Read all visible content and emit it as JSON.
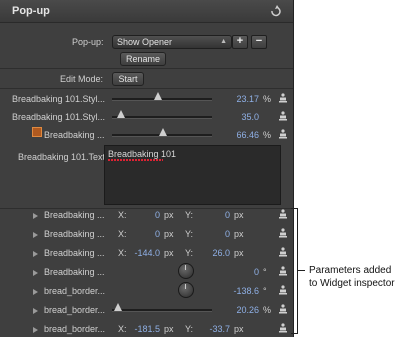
{
  "inspector": {
    "title": "Pop-up",
    "popup_label": "Pop-up:",
    "popup_value": "Show Opener",
    "plus": "+",
    "minus": "−",
    "rename": "Rename",
    "edit_mode_label": "Edit Mode:",
    "start": "Start"
  },
  "sliders": [
    {
      "label": "Breadbaking 101.Styl...",
      "value": "23.17",
      "unit": "%",
      "position": 0.42
    },
    {
      "label": "Breadbaking 101.Styl...",
      "value": "35.0",
      "unit": "",
      "position": 0.05
    },
    {
      "label": "Breadbaking ...",
      "value": "66.46",
      "unit": "%",
      "position": 0.47
    }
  ],
  "text_param": {
    "label": "Breadbaking 101.Text",
    "value": "Breadbaking 101"
  },
  "rows": [
    {
      "label": "Breadbaking ...",
      "x_label": "X:",
      "x": "0",
      "x_unit": "px",
      "y_label": "Y:",
      "y": "0",
      "y_unit": "px"
    },
    {
      "label": "Breadbaking ...",
      "x_label": "X:",
      "x": "0",
      "x_unit": "px",
      "y_label": "Y:",
      "y": "0",
      "y_unit": "px"
    },
    {
      "label": "Breadbaking ...",
      "x_label": "X:",
      "x": "-144.0",
      "x_unit": "px",
      "y_label": "Y:",
      "y": "26.0",
      "y_unit": "px"
    },
    {
      "label": "Breadbaking ...",
      "value": "0",
      "unit": "°"
    },
    {
      "label": "bread_border...",
      "value": "-138.6",
      "unit": "°"
    },
    {
      "label": "bread_border...",
      "value": "20.26",
      "unit": "%"
    },
    {
      "label": "bread_border...",
      "x_label": "X:",
      "x": "-181.5",
      "x_unit": "px",
      "y_label": "Y:",
      "y": "-33.7",
      "y_unit": "px"
    }
  ],
  "annotation": [
    "Parameters added",
    "to Widget inspector"
  ],
  "colors": {
    "panel": "#3f3f3f",
    "value_blue": "#8fb0e6"
  }
}
